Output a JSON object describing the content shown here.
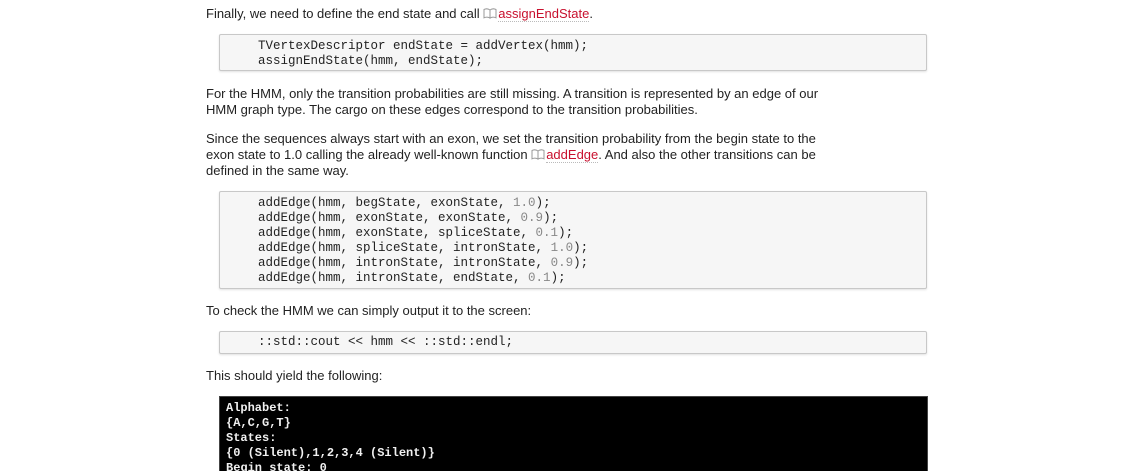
{
  "para1": {
    "text": "Finally, we need to define the end state and call ",
    "link": "assignEndState",
    "suffix": "."
  },
  "code1": [
    "TVertexDescriptor endState = addVertex(hmm);",
    "assignEndState(hmm, endState);"
  ],
  "para2": {
    "line1": "For the HMM, only the transition probabilities are still missing. A transition is represented by an edge of our",
    "line2": "HMM graph type. The cargo on these edges correspond to the transition probabilities."
  },
  "para3": {
    "line1": "Since the sequences always start with an exon, we set the transition probability from the begin state to the",
    "line2_prefix": "exon state to 1.0 calling the already well-known function ",
    "line2_link": "addEdge",
    "line2_suffix": ". And also the other transitions can be",
    "line3": "defined in the same way."
  },
  "code2": [
    {
      "code": "addEdge(hmm, begState, exonState, ",
      "num": "1.0",
      "end": ");"
    },
    {
      "code": "addEdge(hmm, exonState, exonState, ",
      "num": "0.9",
      "end": ");"
    },
    {
      "code": "addEdge(hmm, exonState, spliceState, ",
      "num": "0.1",
      "end": ");"
    },
    {
      "code": "addEdge(hmm, spliceState, intronState, ",
      "num": "1.0",
      "end": ");"
    },
    {
      "code": "addEdge(hmm, intronState, intronState, ",
      "num": "0.9",
      "end": ");"
    },
    {
      "code": "addEdge(hmm, intronState, endState, ",
      "num": "0.1",
      "end": ");"
    }
  ],
  "para4": "To check the HMM we can simply output it to the screen:",
  "code3": "::std::cout << hmm << ::std::endl;",
  "para5": "This should yield the following:",
  "terminal": [
    "Alphabet:",
    "{A,C,G,T}",
    "States:",
    "{0 (Silent),1,2,3,4 (Silent)}",
    "Begin state: 0"
  ],
  "colors": {
    "link": "#c8102e",
    "number": "#888888",
    "terminal_bg": "#000000"
  },
  "icons": {
    "doc_link": "open-book-icon"
  }
}
